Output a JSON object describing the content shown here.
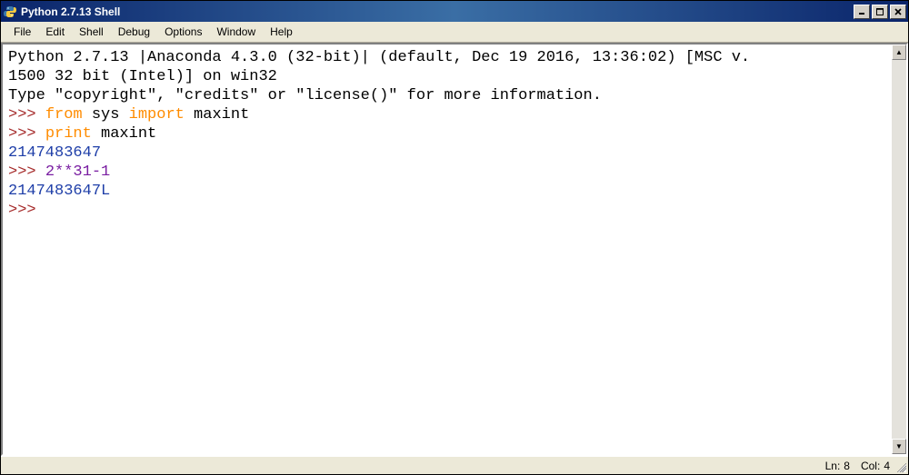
{
  "title": "Python 2.7.13 Shell",
  "menu": [
    "File",
    "Edit",
    "Shell",
    "Debug",
    "Options",
    "Window",
    "Help"
  ],
  "banner": {
    "line1": "Python 2.7.13 |Anaconda 4.3.0 (32-bit)| (default, Dec 19 2016, 13:36:02) [MSC v.",
    "line2": "1500 32 bit (Intel)] on win32",
    "line3": "Type \"copyright\", \"credits\" or \"license()\" for more information."
  },
  "session": {
    "prompt": ">>> ",
    "line1_kw1": "from",
    "line1_t1": " sys ",
    "line1_kw2": "import",
    "line1_t2": " maxint",
    "line2_kw": "print",
    "line2_t": " maxint",
    "out1": "2147483647",
    "line3_in": "2**31-1",
    "out2": "2147483647L"
  },
  "status": {
    "ln_label": "Ln:",
    "ln_value": "8",
    "col_label": "Col:",
    "col_value": "4"
  }
}
